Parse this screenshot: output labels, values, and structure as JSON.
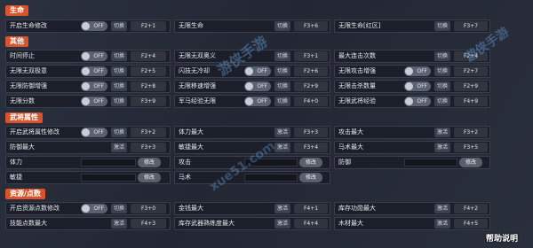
{
  "colors": {
    "section_bg": "#d9542a",
    "row_bg": "#1c1f29",
    "toggle_bg": "#5b6172",
    "modify_bg": "#5a5f6c"
  },
  "sections": {
    "life": "生命",
    "other": "其他",
    "general": "武将属性",
    "resources": "资源/点数"
  },
  "toggle_label": "OFF",
  "switch_label": "切换",
  "activate_label": "激活",
  "modify_label": "修改",
  "life_rows": [
    {
      "label": "开启生命修改",
      "action": "切换",
      "key": "F2+1"
    },
    {
      "label": "无限生命",
      "action": "切换",
      "key": "F3+6"
    },
    {
      "label": "无限生命[红区]",
      "action": "切换",
      "key": "F3+7"
    }
  ],
  "other_rows": [
    {
      "label": "时间停止",
      "action": "切换",
      "key": "F2+4"
    },
    {
      "label": "无限无双奥义",
      "action": "切换",
      "key": "F3+1"
    },
    {
      "label": "最大连击次数",
      "action": "切换",
      "key": "F2+4"
    },
    {
      "label": "无限无双极意",
      "action": "切换",
      "key": "F2+5"
    },
    {
      "label": "闪技无冷却",
      "action": "切换",
      "key": "F2+6"
    },
    {
      "label": "无限攻击增强",
      "action": "切换",
      "key": "F2+7"
    },
    {
      "label": "无限防御增强",
      "action": "切换",
      "key": "F2+8"
    },
    {
      "label": "无限移速增强",
      "action": "切换",
      "key": "F2+9"
    },
    {
      "label": "无限击杀数量",
      "action": "切换",
      "key": "F2+9"
    },
    {
      "label": "无限分数",
      "action": "切换",
      "key": "F3+9"
    },
    {
      "label": "军马经验无限",
      "action": "切换",
      "key": "F4+0"
    },
    {
      "label": "无限武将经验",
      "action": "切换",
      "key": "F4+9"
    }
  ],
  "general_toggle_rows": [
    {
      "label": "开启武将属性修改",
      "action": "切换",
      "key": "F3+2"
    },
    {
      "label": "体力最大",
      "action": "激活",
      "key": "F3+3"
    },
    {
      "label": "攻击最大",
      "action": "激活",
      "key": "F3+2"
    },
    {
      "label": "防御最大",
      "action": "激活",
      "key": "F3+3"
    },
    {
      "label": "敏捷最大",
      "action": "激活",
      "key": "F3+4"
    },
    {
      "label": "马术最大",
      "action": "激活",
      "key": "F3+5"
    }
  ],
  "general_modify_rows": [
    {
      "label": "体力"
    },
    {
      "label": "攻击"
    },
    {
      "label": "防御"
    },
    {
      "label": "敏捷"
    },
    {
      "label": "马术"
    }
  ],
  "resource_rows": [
    {
      "label": "开启资源点数修改",
      "action": "切换",
      "key": "F3+0"
    },
    {
      "label": "金钱最大",
      "action": "激活",
      "key": "F4+1"
    },
    {
      "label": "库存功勋最大",
      "action": "激活",
      "key": "F4+2"
    },
    {
      "label": "技能点数最大",
      "action": "激活",
      "key": "F4+3"
    },
    {
      "label": "库存武器熟练度最大",
      "action": "激活",
      "key": "F4+4"
    },
    {
      "label": "木材最大",
      "action": "激活",
      "key": "F4+5"
    }
  ],
  "help_label": "帮助说明",
  "watermarks": [
    "游侠手游",
    "游侠手游",
    "xue51.com"
  ]
}
